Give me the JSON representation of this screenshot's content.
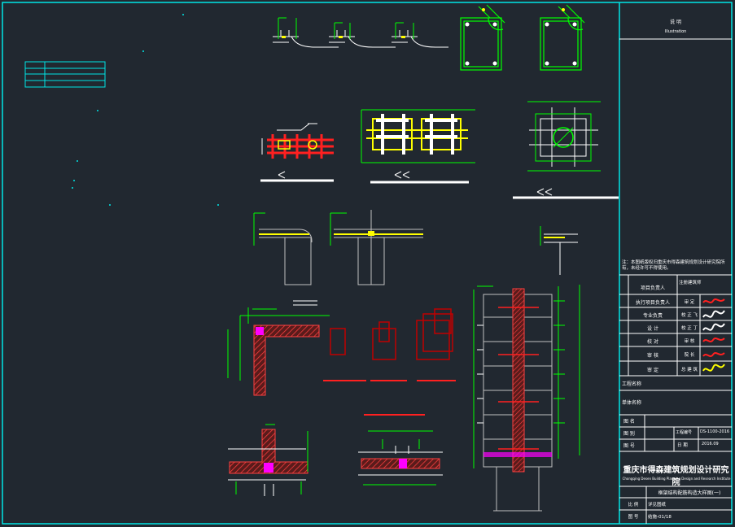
{
  "colors": {
    "background": "#212830",
    "frame": "#00e5e5",
    "green": "#00ff00",
    "yellow": "#ffff00",
    "red": "#ff2020",
    "darkred": "#c00000",
    "white": "#ffffff",
    "grey": "#bfbfbf",
    "magenta": "#ff00ff",
    "hatch": "#ff4040"
  },
  "title_block": {
    "header_title": "说 明",
    "header_subtitle": "Illustration",
    "note": "注：本图纸版权归重庆市得森建筑规划设计研究院所有，未经许可不得使用。",
    "row_project_manager_label": "项目负责人",
    "row_project_manager_value": "注册建筑师",
    "row_cert_value": "",
    "rows": [
      {
        "label": "执行项目负责人",
        "role": "审 定"
      },
      {
        "label": "专业负责",
        "role": "校 正 飞"
      },
      {
        "label": "设 计",
        "role": "校 正 丁"
      },
      {
        "label": "校 对",
        "role": "审 核"
      },
      {
        "label": "审 核",
        "role": "院 长"
      },
      {
        "label": "审 定",
        "role": "总 建 筑"
      }
    ],
    "project_name_label": "工程名称",
    "sub_project_label": "单体名称",
    "drawing_label": "图 名",
    "phase_label": "图 别",
    "drawing_number_label": "工程编号",
    "drawing_number_value": "DS-1100-2016",
    "sheet_label": "图 号",
    "date_label": "日 期",
    "date_value": "2016.09",
    "company_name_cn": "重庆市得森建筑规划设计研究院",
    "company_name_en": "Chongqing Desen Building Planning Design and Research Institute",
    "drawing_title": "框架结构配筋构造大样图(一)",
    "sheet_scale_label": "比 例",
    "sheet_scale_value": "详见图纸",
    "sheet_no_label": "图 号",
    "sheet_no_value": "结施-01/18"
  }
}
